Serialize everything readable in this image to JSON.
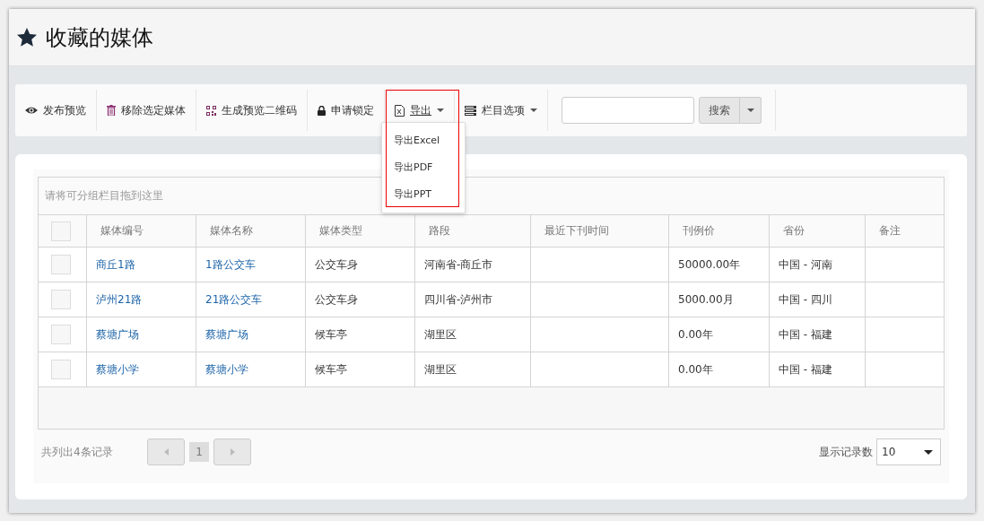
{
  "page": {
    "title": "收藏的媒体"
  },
  "toolbar": {
    "buttons": [
      {
        "label": "发布预览",
        "kind": "eye"
      },
      {
        "label": "移除选定媒体",
        "kind": "trash"
      },
      {
        "label": "生成预览二维码",
        "kind": "qr"
      },
      {
        "label": "申请锁定",
        "kind": "lock"
      }
    ],
    "export": {
      "label": "导出",
      "expanded": true,
      "items": [
        "导出Excel",
        "导出PDF",
        "导出PPT"
      ]
    },
    "columns_menu": {
      "label": "栏目选项"
    },
    "search": {
      "button": "搜索"
    }
  },
  "grid": {
    "group_hint": "请将可分组栏目拖到这里",
    "select_all_checked": false,
    "columns": [
      "媒体编号",
      "媒体名称",
      "媒体类型",
      "路段",
      "最近下刊时间",
      "刊例价",
      "省份",
      "备注"
    ],
    "rows": [
      {
        "checked": false,
        "cells": [
          "商丘1路",
          "1路公交车",
          "公交车身",
          "河南省-商丘市",
          "",
          "50000.00年",
          "中国 - 河南",
          ""
        ]
      },
      {
        "checked": false,
        "cells": [
          "泸州21路",
          "21路公交车",
          "公交车身",
          "四川省-泸州市",
          "",
          "5000.00月",
          "中国 - 四川",
          ""
        ]
      },
      {
        "checked": false,
        "cells": [
          "蔡塘广场",
          "蔡塘广场",
          "候车亭",
          "湖里区",
          "",
          "0.00年",
          "中国 - 福建",
          ""
        ]
      },
      {
        "checked": false,
        "cells": [
          "蔡塘小学",
          "蔡塘小学",
          "候车亭",
          "湖里区",
          "",
          "0.00年",
          "中国 - 福建",
          ""
        ]
      }
    ]
  },
  "footer": {
    "summary": "共列出4条记录",
    "pages": [
      {
        "label": "1",
        "selected": true
      }
    ],
    "page_size_label": "显示记录数",
    "page_size": "10"
  }
}
